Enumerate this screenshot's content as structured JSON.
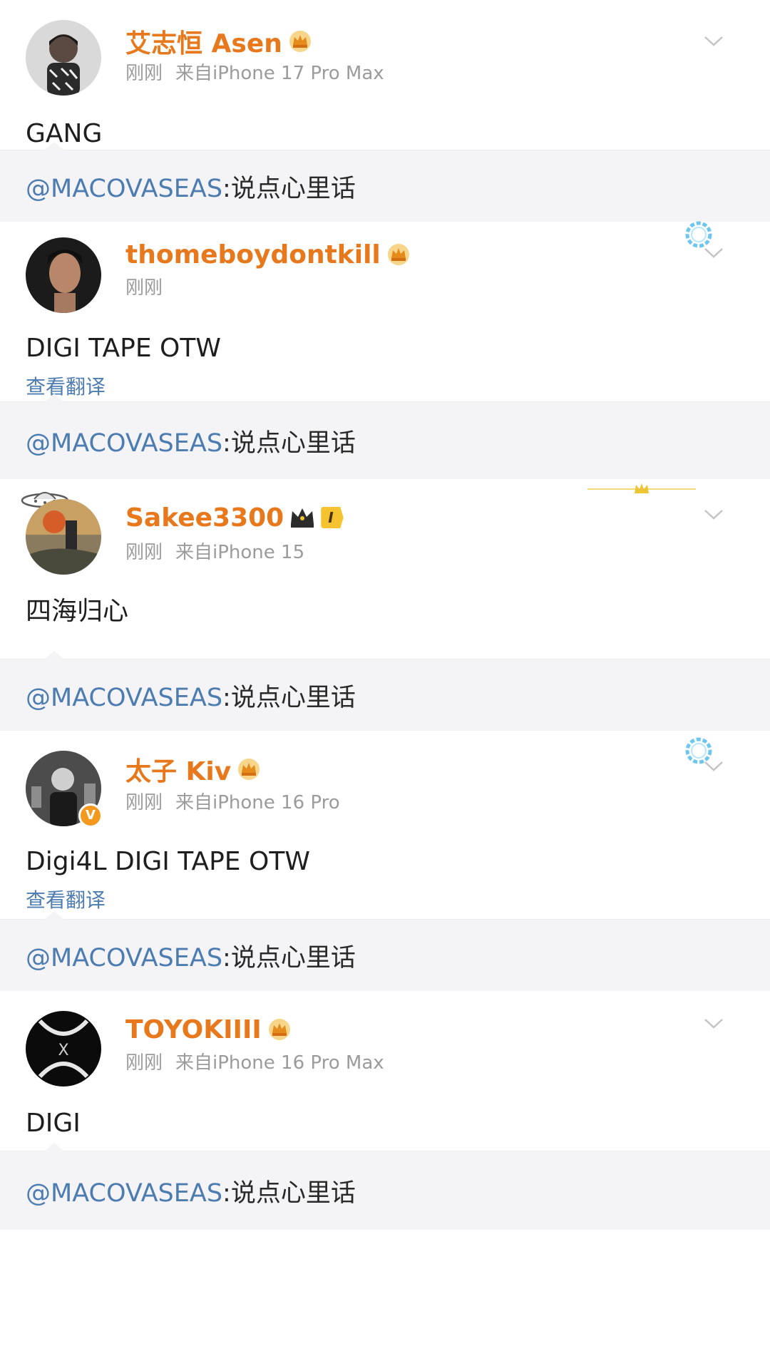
{
  "posts": [
    {
      "username": "艾志恒 Asen",
      "time": "刚刚",
      "source": "来自iPhone 17 Pro Max",
      "text": "GANG",
      "badge": "crown-icon"
    },
    {
      "username": "thomeboydontkill",
      "time": "刚刚",
      "source": "",
      "text": "DIGI TAPE OTW",
      "translate": "查看翻译",
      "badge": "crown-icon"
    },
    {
      "username": "Sakee3300",
      "time": "刚刚",
      "source": "来自iPhone 15",
      "text": "四海归心",
      "level": "I",
      "badge": "dark-crown-icon"
    },
    {
      "username": "太子 Kiv",
      "time": "刚刚",
      "source": "来自iPhone 16 Pro",
      "text": "Digi4L  DIGI TAPE OTW",
      "translate": "查看翻译",
      "verified_mark": "V",
      "badge": "crown-icon"
    },
    {
      "username": "TOYOKIIII",
      "time": "刚刚",
      "source": "来自iPhone 16 Pro Max",
      "text": "DIGI",
      "badge": "crown-icon"
    }
  ],
  "reply": {
    "handle": "@MACOVASEAS",
    "message": ":说点心里话"
  },
  "colors": {
    "username": "#e8781c",
    "link": "#4d7cb0",
    "meta": "#9b9b9b",
    "reply_bg": "#f4f4f6"
  }
}
